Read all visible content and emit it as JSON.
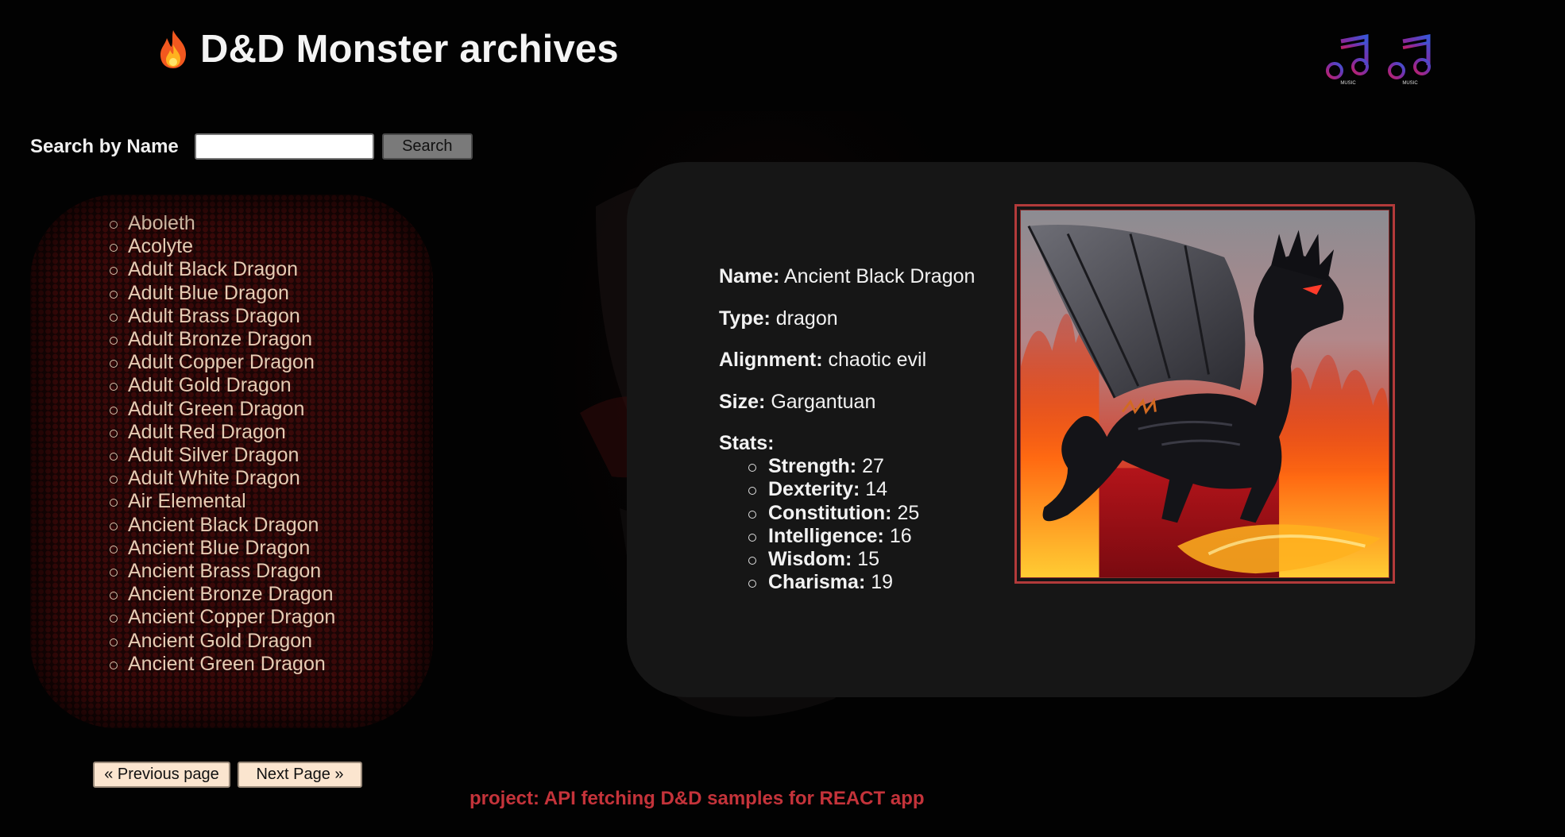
{
  "header": {
    "title": "D&D Monster archives",
    "title_icon": "flame-icon"
  },
  "music": [
    {
      "icon": "music-note-icon",
      "caption": "MUSIC"
    },
    {
      "icon": "music-note-icon",
      "caption": "MUSIC"
    }
  ],
  "search": {
    "label": "Search by Name",
    "value": "",
    "placeholder": "",
    "button_label": "Search"
  },
  "monster_list": [
    "Aboleth",
    "Acolyte",
    "Adult Black Dragon",
    "Adult Blue Dragon",
    "Adult Brass Dragon",
    "Adult Bronze Dragon",
    "Adult Copper Dragon",
    "Adult Gold Dragon",
    "Adult Green Dragon",
    "Adult Red Dragon",
    "Adult Silver Dragon",
    "Adult White Dragon",
    "Air Elemental",
    "Ancient Black Dragon",
    "Ancient Blue Dragon",
    "Ancient Brass Dragon",
    "Ancient Bronze Dragon",
    "Ancient Copper Dragon",
    "Ancient Gold Dragon",
    "Ancient Green Dragon"
  ],
  "pagination": {
    "prev_label": "« Previous page",
    "next_label": "Next Page »"
  },
  "detail": {
    "name_label": "Name:",
    "name": "Ancient Black Dragon",
    "type_label": "Type:",
    "type": "dragon",
    "alignment_label": "Alignment:",
    "alignment": "chaotic evil",
    "size_label": "Size:",
    "size": "Gargantuan",
    "stats_label": "Stats:",
    "stats": [
      {
        "label": "Strength:",
        "value": "27"
      },
      {
        "label": "Dexterity:",
        "value": "14"
      },
      {
        "label": "Constitution:",
        "value": "25"
      },
      {
        "label": "Intelligence:",
        "value": "16"
      },
      {
        "label": "Wisdom:",
        "value": "15"
      },
      {
        "label": "Charisma:",
        "value": "19"
      }
    ]
  },
  "footer": {
    "text": "project: API fetching D&D samples for REACT app"
  },
  "colors": {
    "background": "#020202",
    "card": "#161616",
    "list_text": "#e6ccb4",
    "footer_text": "#c4333a",
    "image_border": "#b23a3a"
  }
}
